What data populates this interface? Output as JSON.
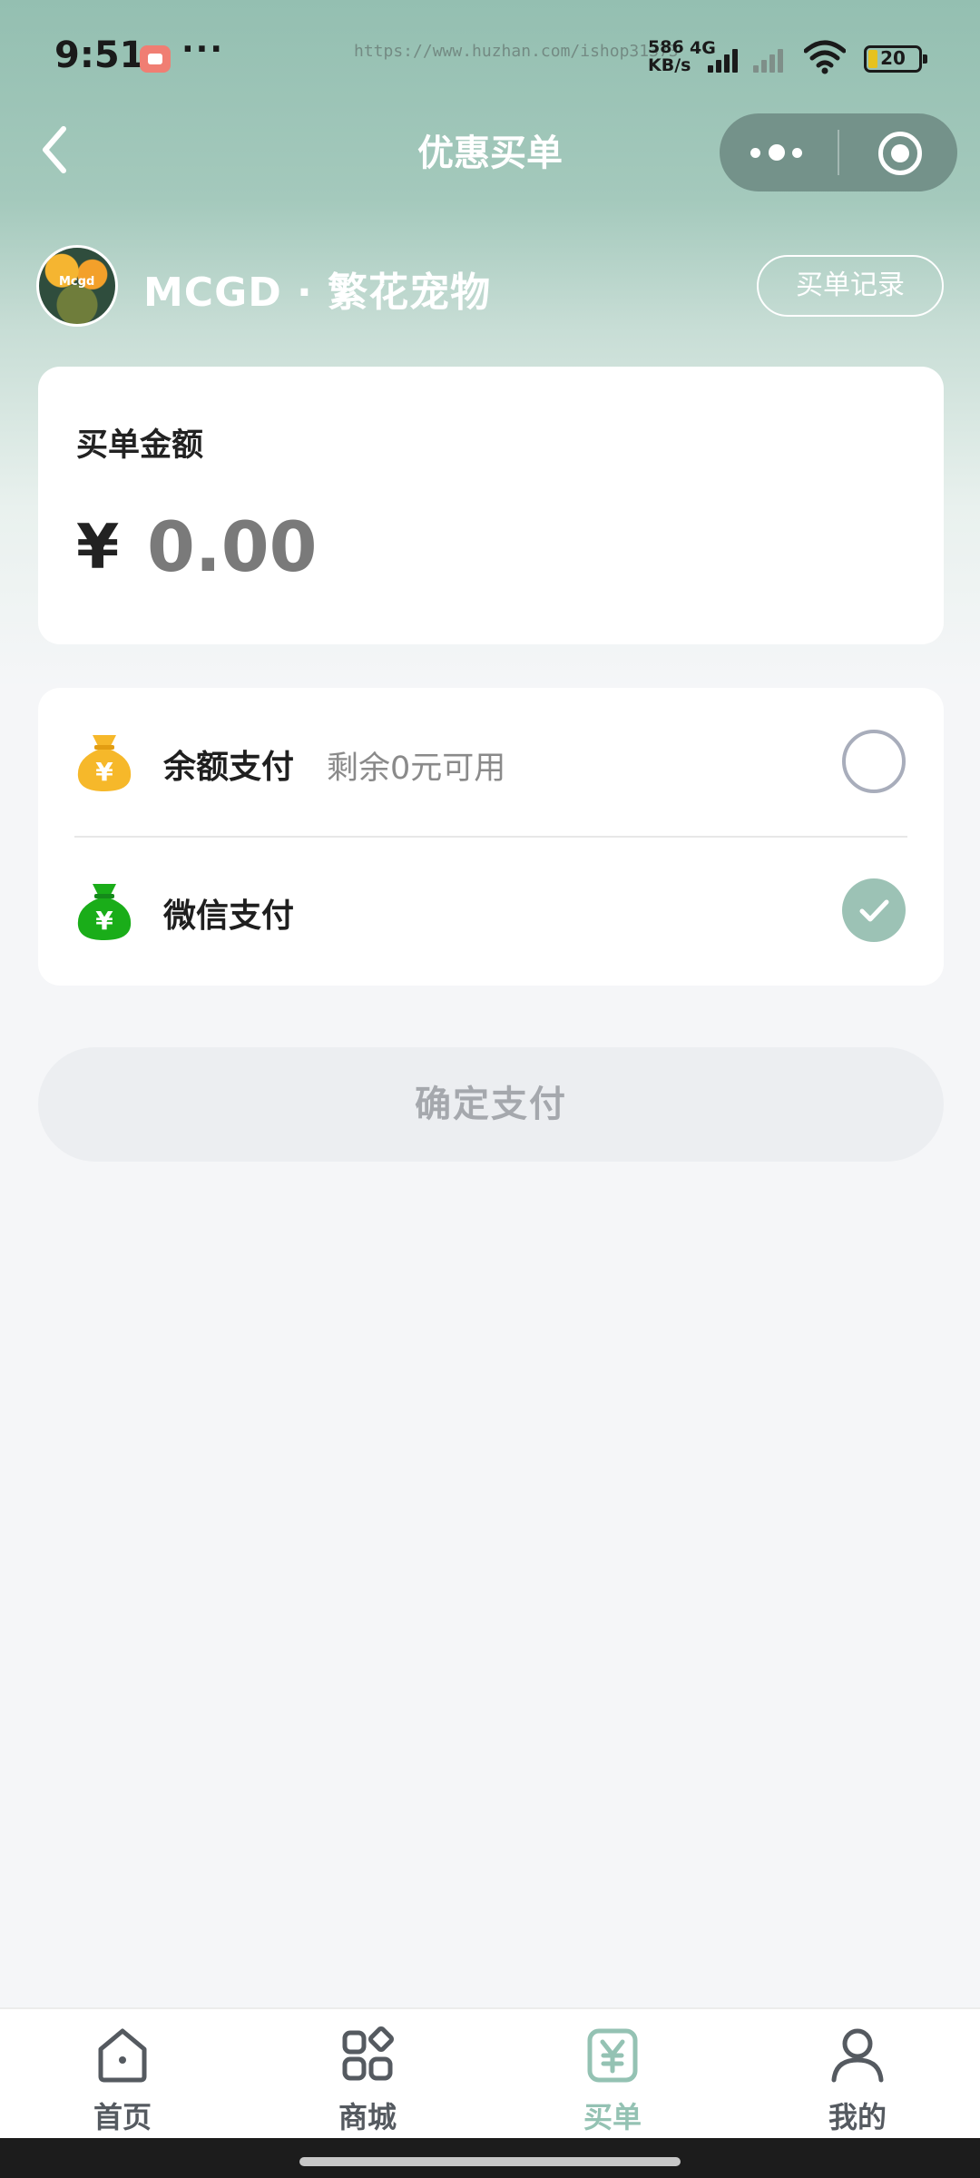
{
  "status_bar": {
    "time": "9:51",
    "dots": "···",
    "url_watermark": "https://www.huzhan.com/ishop31373",
    "net_speed_value": "586",
    "net_speed_unit": "KB/s",
    "network_type": "4G",
    "battery_level": "20"
  },
  "nav": {
    "title": "优惠买单"
  },
  "store": {
    "avatar_text": "Mcgd",
    "name": "MCGD · 繁花宠物",
    "record_button": "买单记录"
  },
  "amount": {
    "label": "买单金额",
    "currency": "¥",
    "value": "0.00"
  },
  "payment": {
    "options": [
      {
        "label": "余额支付",
        "sub": "剩余0元可用",
        "selected": false,
        "icon": "yellow-money-bag-icon",
        "color": "#f6b82a"
      },
      {
        "label": "微信支付",
        "sub": "",
        "selected": true,
        "icon": "green-money-bag-icon",
        "color": "#1aad19"
      }
    ]
  },
  "confirm_button": "确定支付",
  "tabs": [
    {
      "label": "首页",
      "icon": "home-icon",
      "active": false
    },
    {
      "label": "商城",
      "icon": "grid-icon",
      "active": false
    },
    {
      "label": "买单",
      "icon": "yen-receipt-icon",
      "active": true
    },
    {
      "label": "我的",
      "icon": "user-icon",
      "active": false
    }
  ],
  "colors": {
    "accent": "#94c2b3",
    "header": "#94bfb1",
    "capsule": "#74928a"
  }
}
